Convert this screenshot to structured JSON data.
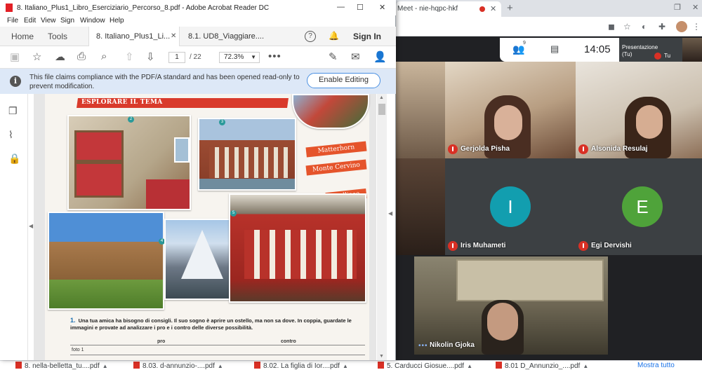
{
  "acrobat": {
    "title": "8. Italiano_Plus1_Libro_Eserciziario_Percorso_8.pdf - Adobe Acrobat Reader DC",
    "menu": [
      "File",
      "Edit",
      "View",
      "Sign",
      "Window",
      "Help"
    ],
    "nav": {
      "home": "Home",
      "tools": "Tools"
    },
    "tabs": [
      {
        "label": "8. Italiano_Plus1_Li...",
        "active": true
      },
      {
        "label": "8.1. UD8_Viaggiare....",
        "active": false
      }
    ],
    "sign_in": "Sign In",
    "toolbar": {
      "page_current": "1",
      "page_total": "/ 22",
      "zoom": "72.3%"
    },
    "info": {
      "message": "This file claims compliance with the PDF/A standard and has been opened read-only to prevent modification.",
      "button": "Enable Editing"
    },
    "page": {
      "section_title": "ESPLORARE IL TEMA",
      "tags": [
        "Matterhorn",
        "Monte Cervino",
        "Stellisee"
      ],
      "numbers": [
        "2",
        "3",
        "4",
        "5"
      ],
      "exercise_number": "1.",
      "exercise_text": "Una tua amica ha bisogno di consigli. Il suo sogno è aprire un ostello, ma non sa dove. In coppia, guardate le immagini e provate ad analizzare i pro e i contro delle diverse possibilità.",
      "table_pro": "pro",
      "table_contro": "contro",
      "table_row1": "foto 1"
    }
  },
  "chrome": {
    "tab_title": "Meet - nie-hqpc-hkf",
    "new_tab": "+"
  },
  "meet": {
    "people_count": "9",
    "time": "14:05",
    "presenting_label": "Presentazione (Tu)",
    "self_label": "Tu",
    "participants": [
      {
        "name": "Gerjolda Pisha"
      },
      {
        "name": "Alsonida Resulaj"
      },
      {
        "name": "Iris Muhameti",
        "initial": "I",
        "color": "#129eaf"
      },
      {
        "name": "Egi Dervishi",
        "initial": "E",
        "color": "#4fa33a"
      },
      {
        "name": "Nikolin Gjoka"
      }
    ]
  },
  "downloads": {
    "items": [
      "8. nella-belletta_tu....pdf",
      "8.03. d-annunzio-....pdf",
      "8.02. La figlia di Ior....pdf",
      "5. Carducci Giosue....pdf",
      "8.01 D_Annunzio_....pdf"
    ],
    "show_all": "Mostra tutto"
  }
}
